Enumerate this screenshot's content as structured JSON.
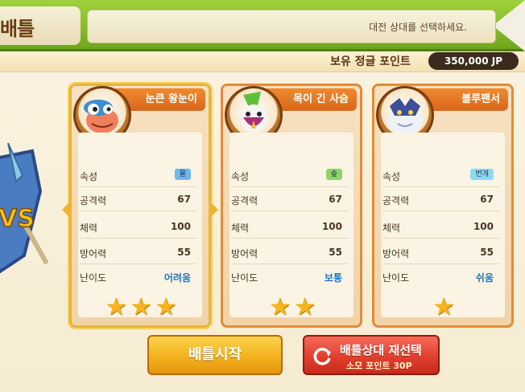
{
  "header": {
    "title": "배틀",
    "hint": "대전 상대를 선택하세요."
  },
  "points": {
    "label": "보유 정글 포인트",
    "value": "350,000 JP"
  },
  "opponents": [
    {
      "name": "눈큰 왕눈이",
      "portrait": "blue-fish-creature",
      "attribute_label": "속성",
      "attribute": "물",
      "attribute_color": "#6fb6ee",
      "attack_label": "공격력",
      "attack": "67",
      "stamina_label": "체력",
      "stamina": "100",
      "defense_label": "방어력",
      "defense": "55",
      "difficulty_label": "난이도",
      "difficulty": "어려움",
      "stars": 3,
      "selected": true
    },
    {
      "name": "목이 긴 사슴",
      "portrait": "long-neck-bird-creature",
      "attribute_label": "속성",
      "attribute": "숲",
      "attribute_color": "#8fd36a",
      "attack_label": "공격력",
      "attack": "67",
      "stamina_label": "체력",
      "stamina": "100",
      "defense_label": "방어력",
      "defense": "55",
      "difficulty_label": "난이도",
      "difficulty": "보통",
      "stars": 2,
      "selected": false
    },
    {
      "name": "블루팬서",
      "portrait": "blue-panther-creature",
      "attribute_label": "속성",
      "attribute": "번개",
      "attribute_color": "#8fd8f2",
      "attack_label": "공격력",
      "attack": "67",
      "stamina_label": "체력",
      "stamina": "100",
      "defense_label": "방어력",
      "defense": "55",
      "difficulty_label": "난이도",
      "difficulty": "쉬움",
      "stars": 1,
      "selected": false
    }
  ],
  "buttons": {
    "start": "배틀시작",
    "reselect": "배틀상대 재선택",
    "reselect_cost": "소모 포인트 30P"
  },
  "emblem": {
    "text": "VS"
  }
}
